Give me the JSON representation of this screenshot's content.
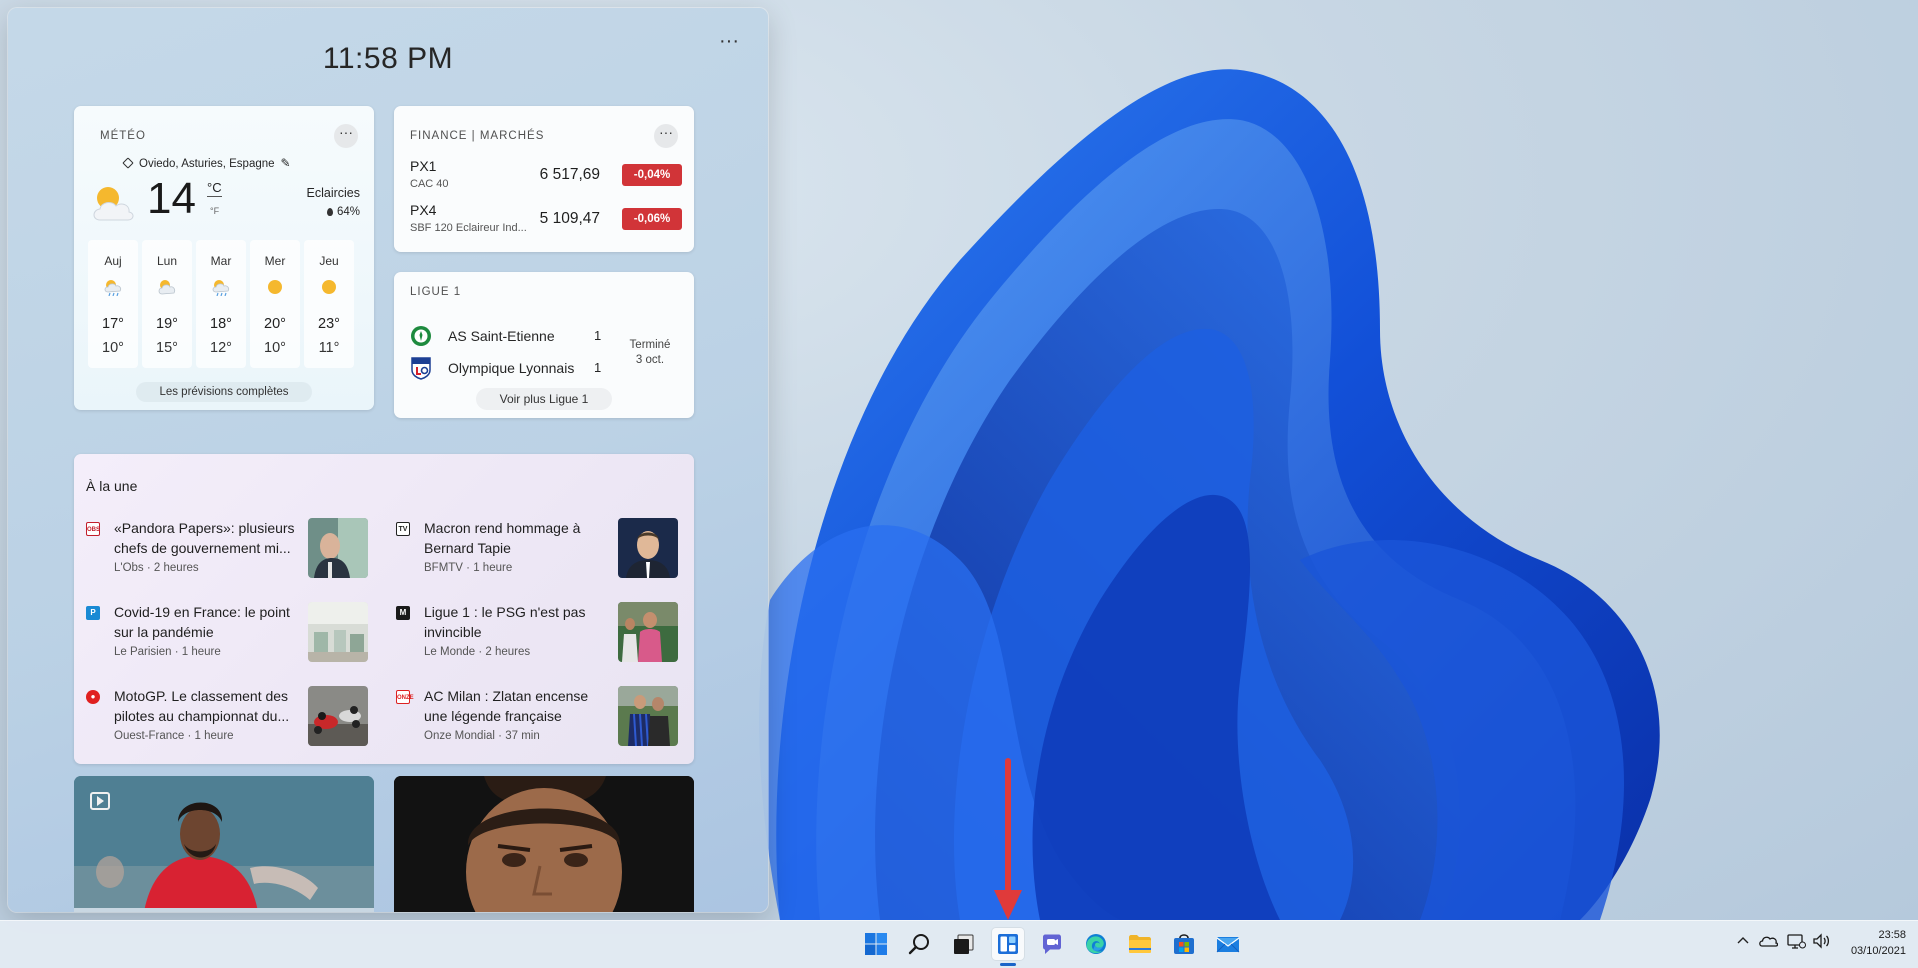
{
  "widgets": {
    "time": "11:58 PM",
    "more_label": "···",
    "weather": {
      "title": "MÉTÉO",
      "location": "Oviedo, Asturies, Espagne",
      "temperature": "14",
      "unit_c": "°C",
      "unit_f": "°F",
      "condition": "Eclaircies",
      "humidity": "64%",
      "forecast": [
        {
          "day": "Auj",
          "high": "17°",
          "low": "10°",
          "icon": "rain-cloud-icon"
        },
        {
          "day": "Lun",
          "high": "19°",
          "low": "15°",
          "icon": "partly-cloudy-icon"
        },
        {
          "day": "Mar",
          "high": "18°",
          "low": "12°",
          "icon": "rain-cloud-icon"
        },
        {
          "day": "Mer",
          "high": "20°",
          "low": "10°",
          "icon": "sun-icon"
        },
        {
          "day": "Jeu",
          "high": "23°",
          "low": "11°",
          "icon": "sun-icon"
        }
      ],
      "full_forecast_link": "Les prévisions complètes"
    },
    "finance": {
      "title": "FINANCE | MARCHÉS",
      "stocks": [
        {
          "symbol": "PX1",
          "name": "CAC 40",
          "price": "6 517,69",
          "change": "-0,04%"
        },
        {
          "symbol": "PX4",
          "name": "SBF 120 Eclaireur Ind...",
          "price": "5 109,47",
          "change": "-0,06%"
        }
      ],
      "negative_color": "#d13438"
    },
    "ligue1": {
      "title": "LIGUE 1",
      "home_team": "AS Saint-Etienne",
      "home_score": "1",
      "away_team": "Olympique Lyonnais",
      "away_score": "1",
      "status": "Terminé",
      "date": "3 oct.",
      "more_link": "Voir plus Ligue 1"
    },
    "news": {
      "title": "À la une",
      "items": [
        {
          "title": "«Pandora Papers»: plusieurs chefs de gouvernement mi...",
          "source": "L'Obs",
          "age": "2 heures"
        },
        {
          "title": "Macron rend hommage à Bernard Tapie",
          "source": "BFMTV",
          "age": "1 heure"
        },
        {
          "title": "Covid-19 en France: le point sur la pandémie",
          "source": "Le Parisien",
          "age": "1 heure"
        },
        {
          "title": "Ligue 1 : le PSG n'est pas invincible",
          "source": "Le Monde",
          "age": "2 heures"
        },
        {
          "title": "MotoGP. Le classement des pilotes au championnat du...",
          "source": "Ouest-France",
          "age": "1 heure"
        },
        {
          "title": "AC Milan : Zlatan encense une légende française",
          "source": "Onze Mondial",
          "age": "37 min"
        }
      ],
      "sep": " · "
    }
  },
  "taskbar": {
    "icons": [
      "windows-start-icon",
      "search-icon",
      "task-view-icon",
      "widgets-icon",
      "teams-chat-icon",
      "edge-icon",
      "file-explorer-icon",
      "microsoft-store-icon",
      "mail-icon"
    ],
    "active": "widgets-icon",
    "accent": "#1b64c8",
    "tray": [
      "chevron-up-icon",
      "onedrive-icon",
      "network-icon",
      "volume-icon"
    ],
    "clock_time": "23:58",
    "clock_date": "03/10/2021"
  },
  "annotation": {
    "color": "#e03a3a",
    "shape": "down-arrow"
  }
}
